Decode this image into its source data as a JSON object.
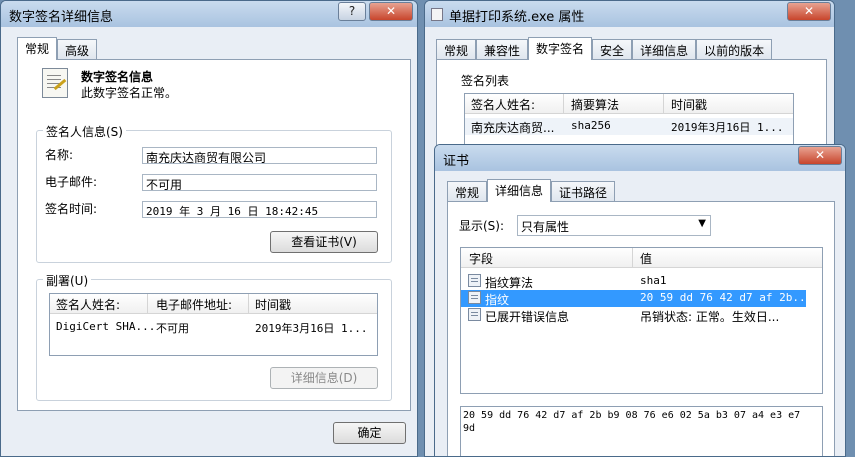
{
  "win1": {
    "title": "数字签名详细信息",
    "help": "?",
    "close": "✕",
    "tabs": [
      "常规",
      "高级"
    ],
    "info_title": "数字签名信息",
    "info_sub": "此数字签名正常。",
    "signer_group": "签名人信息(S)",
    "name_label": "名称:",
    "name_value": "南充庆达商贸有限公司",
    "email_label": "电子邮件:",
    "email_value": "不可用",
    "time_label": "签名时间:",
    "time_value": "  2019  年  3  月  16  日 18:42:45",
    "view_cert": "查看证书(V)",
    "counter_group": "副署(U)",
    "counter_headers": [
      "签名人姓名:",
      "电子邮件地址:",
      "时间戳"
    ],
    "counter_row": [
      "DigiCert SHA...",
      "不可用",
      "2019年3月16日 1..."
    ],
    "details_btn": "详细信息(D)",
    "ok": "确定"
  },
  "win2": {
    "title": "单据打印系统.exe 属性",
    "close": "✕",
    "tabs": [
      "常规",
      "兼容性",
      "数字签名",
      "安全",
      "详细信息",
      "以前的版本"
    ],
    "sig_list_label": "签名列表",
    "headers": [
      "签名人姓名:",
      "摘要算法",
      "时间戳"
    ],
    "row": [
      "南充庆达商贸...",
      "sha256",
      "2019年3月16日 1..."
    ]
  },
  "win3": {
    "title": "证书",
    "close": "✕",
    "tabs": [
      "常规",
      "详细信息",
      "证书路径"
    ],
    "show_label": "显示(S):",
    "show_value": "只有属性",
    "headers": [
      "字段",
      "值"
    ],
    "rows": [
      {
        "field": "指纹算法",
        "value": "sha1",
        "selected": false
      },
      {
        "field": "指纹",
        "value": "20 59 dd 76 42 d7 af 2b...",
        "selected": true
      },
      {
        "field": "已展开错误信息",
        "value": "吊销状态: 正常。生效日...",
        "selected": false
      }
    ],
    "detail_line1": " 20 59 dd 76 42 d7 af 2b b9 08 76 e6 02 5a b3 07 a4 e3 e7",
    "detail_line2": "9d"
  }
}
